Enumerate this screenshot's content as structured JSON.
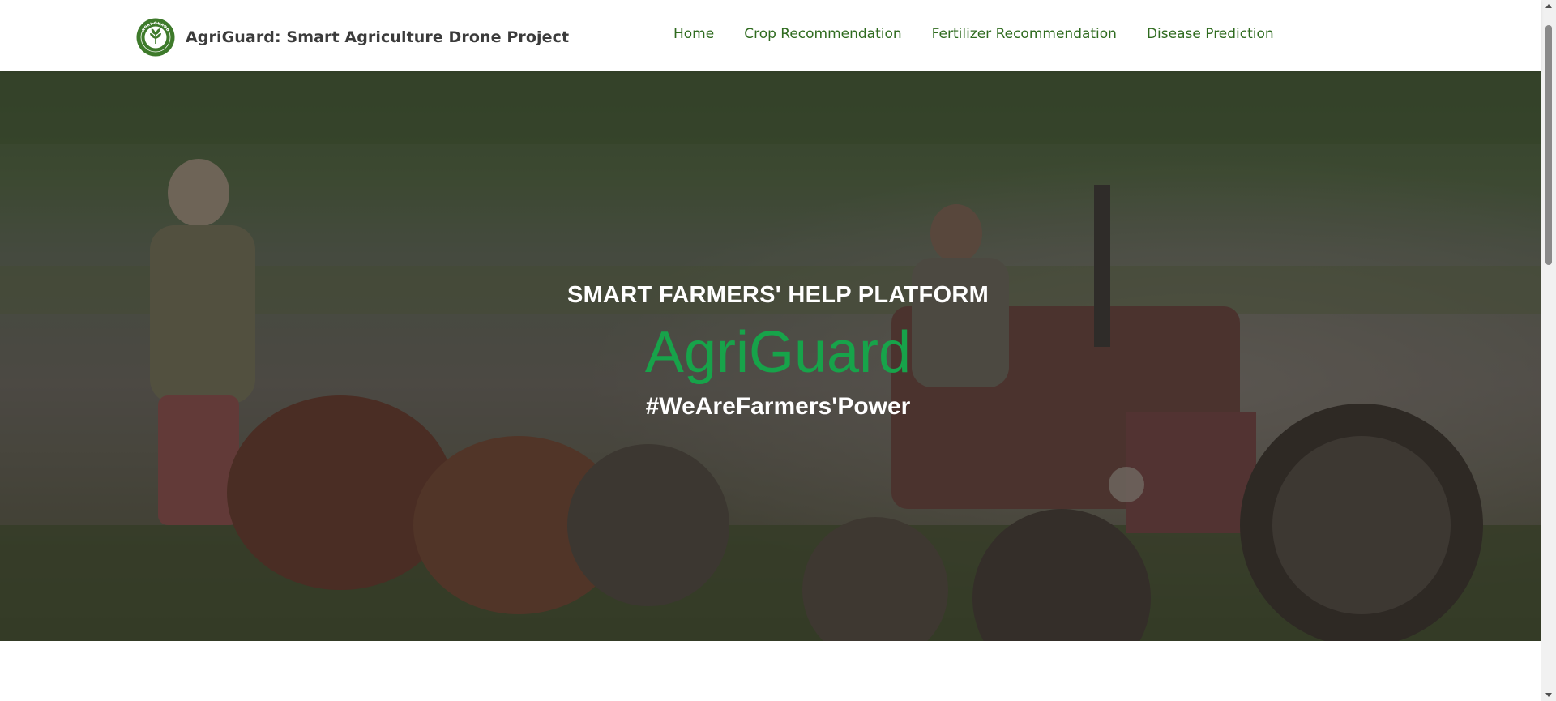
{
  "navbar": {
    "brand_title": "AgriGuard: Smart Agriculture Drone Project",
    "logo_icon": "leaf-shield-logo-icon",
    "logo_ring_text": "AGRI GUARD",
    "links": [
      {
        "label": "Home"
      },
      {
        "label": "Crop Recommendation"
      },
      {
        "label": "Fertilizer Recommendation"
      },
      {
        "label": "Disease Prediction"
      }
    ]
  },
  "hero": {
    "background": "farmers-plowing-field-photo",
    "tagline": "SMART FARMERS' HELP PLATFORM",
    "title": "AgriGuard",
    "hashtag": "#WeAreFarmers'Power"
  },
  "colors": {
    "brand_green": "#17a34a",
    "nav_link_green": "#2f6b1f",
    "logo_green": "#3e7a2b",
    "brand_text": "#3b3b3b",
    "hero_overlay": "#23211f"
  },
  "scrollbar": {
    "up_icon": "scroll-up-arrow-icon",
    "down_icon": "scroll-down-arrow-icon"
  }
}
